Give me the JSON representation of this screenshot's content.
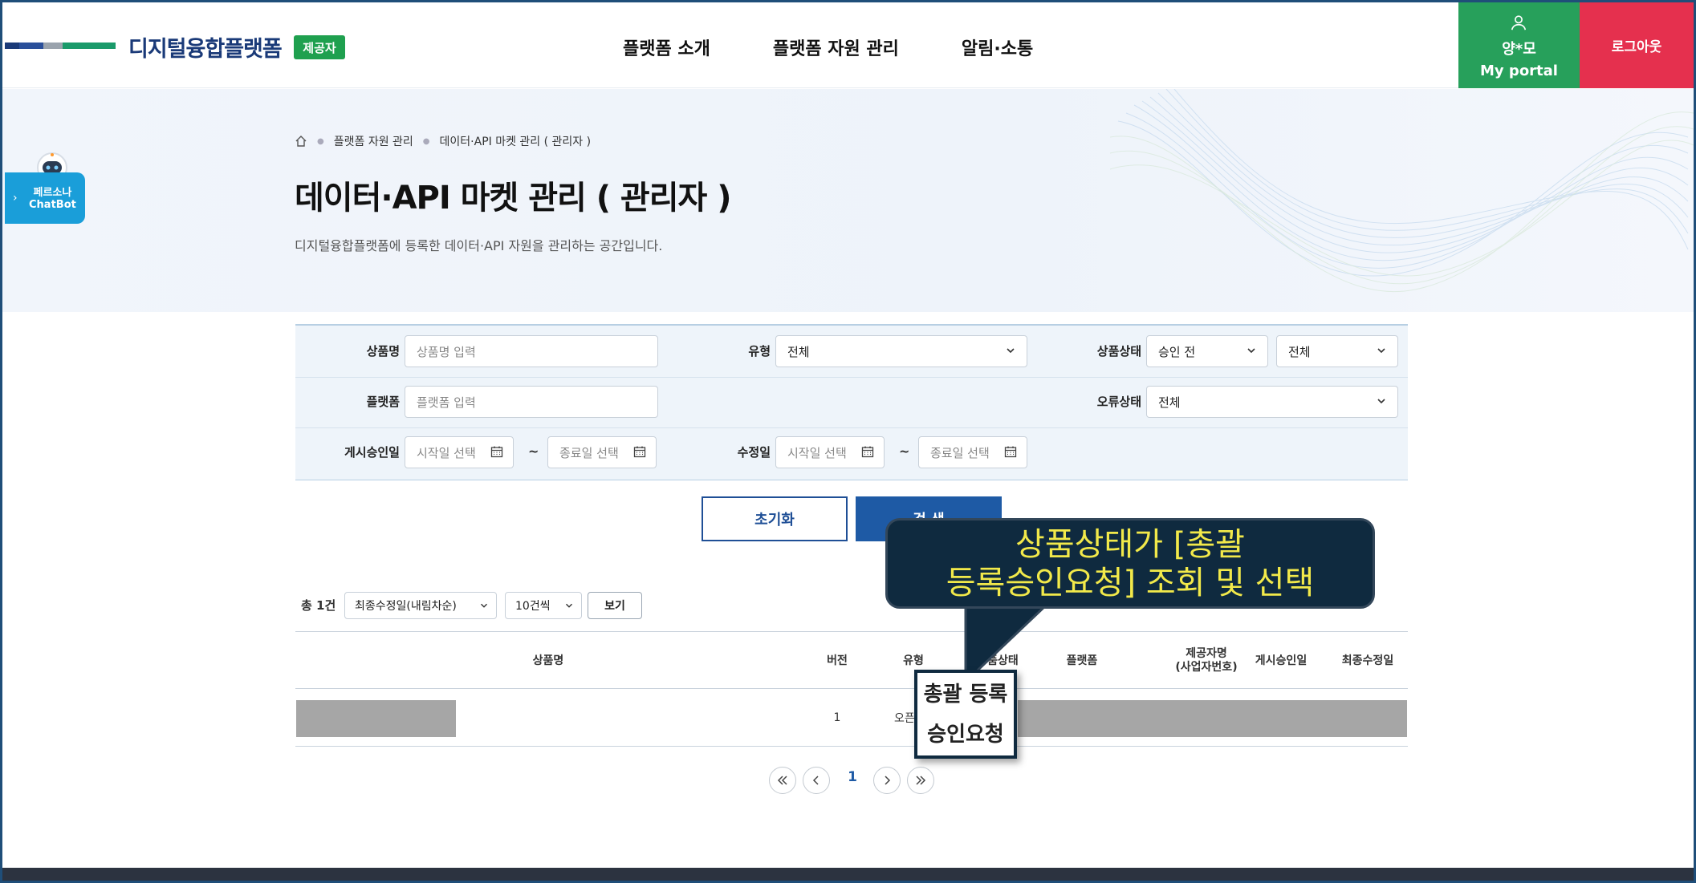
{
  "header": {
    "logo_text": "디지털융합플랫폼",
    "badge": "제공자",
    "nav": [
      "플랫폼 소개",
      "플랫폼 자원 관리",
      "알림·소통"
    ],
    "user_name": "양*모",
    "portal_label": "My portal",
    "logout_label": "로그아웃"
  },
  "chatbot": {
    "label_line1": "페르소나",
    "label_line2": "ChatBot"
  },
  "breadcrumb": [
    "플랫폼 자원 관리",
    "데이터·API 마켓 관리 ( 관리자 )"
  ],
  "page": {
    "title": "데이터·API 마켓 관리 ( 관리자 )",
    "description": "디지털융합플랫폼에 등록한 데이터·API 자원을 관리하는 공간입니다."
  },
  "search": {
    "product_name_label": "상품명",
    "product_name_placeholder": "상품명 입력",
    "type_label": "유형",
    "type_value": "전체",
    "status_label": "상품상태",
    "status_value1": "승인 전",
    "status_value2": "전체",
    "platform_label": "플랫폼",
    "platform_placeholder": "플랫폼 입력",
    "error_label": "오류상태",
    "error_value": "전체",
    "approval_date_label": "게시승인일",
    "modified_date_label": "수정일",
    "start_placeholder": "시작일 선택",
    "end_placeholder": "종료일 선택",
    "tilde": "~"
  },
  "buttons": {
    "reset": "초기화",
    "search": "검 색"
  },
  "list": {
    "total": "총 1건",
    "sort_value": "최종수정일(내림차순)",
    "page_size_value": "10건씩",
    "view_button": "보기"
  },
  "table": {
    "headers": {
      "name": "상품명",
      "version": "버전",
      "type": "유형",
      "status": "상품상태",
      "platform": "플랫폼",
      "provider_line1": "제공자명",
      "provider_line2": "(사업자번호)",
      "approval_date": "게시승인일",
      "modified_date": "최종수정일"
    },
    "row": {
      "version": "1",
      "type": "오픈API"
    }
  },
  "pagination": {
    "current": "1"
  },
  "annotation": {
    "line1": "상품상태가 [총괄",
    "line2": "등록승인요청] 조회 및 선택",
    "zoom_line1": "총괄 등록",
    "zoom_line2": "승인요청"
  },
  "colors": {
    "brand_navy": "#1a3a78",
    "badge_green": "#1fa04f",
    "user_green": "#27a05b",
    "logout_red": "#e5304e",
    "primary_blue": "#1e5aa5",
    "callout_bg": "#0f2a3f",
    "callout_text": "#f2e94a"
  }
}
